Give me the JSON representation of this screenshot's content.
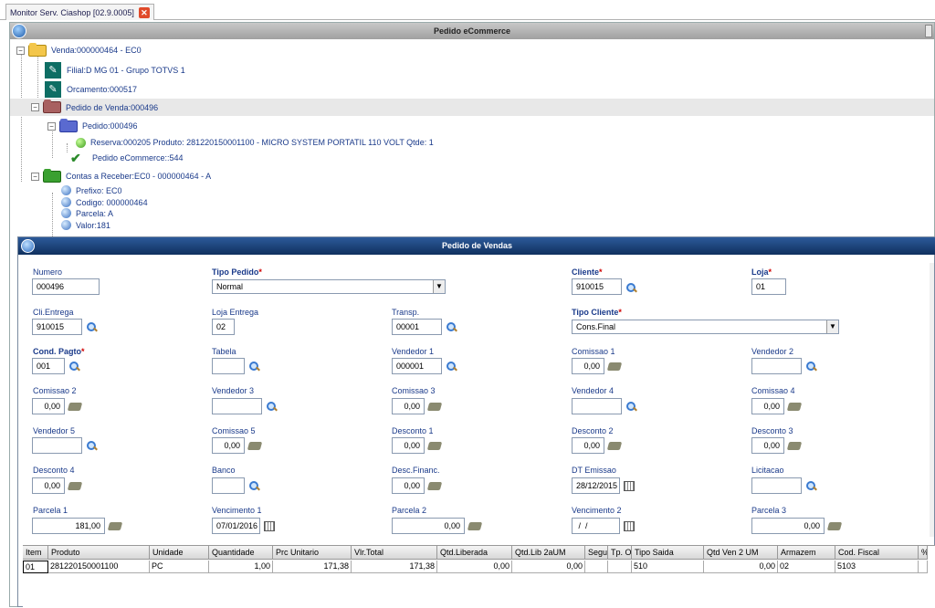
{
  "tab": {
    "title": "Monitor Serv. Ciashop [02.9.0005]"
  },
  "outer_title": "Pedido eCommerce",
  "tree": {
    "venda": "Venda:000000464 - EC0",
    "filial": "Filial:D MG 01  - Grupo TOTVS 1",
    "orcamento": "Orcamento:000517",
    "pedido_venda": "Pedido de Venda:000496",
    "pedido": "Pedido:000496",
    "reserva": "Reserva:000205 Produto: 281220150001100 - MICRO SYSTEM PORTATIL 110 VOLT Qtde: 1",
    "pedido_ecommerce": "Pedido eCommerce::544",
    "contas": "Contas a Receber:EC0 - 000000464 - A",
    "prefixo": "Prefixo: EC0",
    "codigo": "Codigo: 000000464",
    "parcela": "Parcela: A",
    "valor": "Valor:181"
  },
  "panel_title": "Pedido de Vendas",
  "form": {
    "numero": {
      "label": "Numero",
      "value": "000496"
    },
    "tipo_pedido": {
      "label": "Tipo Pedido",
      "value": "Normal"
    },
    "cliente": {
      "label": "Cliente",
      "value": "910015"
    },
    "loja": {
      "label": "Loja",
      "value": "01"
    },
    "cli_entrega": {
      "label": "Cli.Entrega",
      "value": "910015"
    },
    "loja_entrega": {
      "label": "Loja Entrega",
      "value": "02"
    },
    "transp": {
      "label": "Transp.",
      "value": "00001"
    },
    "tipo_cliente": {
      "label": "Tipo Cliente",
      "value": "Cons.Final"
    },
    "cond_pagto": {
      "label": "Cond. Pagto",
      "value": "001"
    },
    "tabela": {
      "label": "Tabela",
      "value": ""
    },
    "vendedor1": {
      "label": "Vendedor 1",
      "value": "000001"
    },
    "comissao1": {
      "label": "Comissao 1",
      "value": "0,00"
    },
    "vendedor2": {
      "label": "Vendedor 2",
      "value": ""
    },
    "comissao2": {
      "label": "Comissao 2",
      "value": "0,00"
    },
    "vendedor3": {
      "label": "Vendedor 3",
      "value": ""
    },
    "comissao3": {
      "label": "Comissao 3",
      "value": "0,00"
    },
    "vendedor4": {
      "label": "Vendedor 4",
      "value": ""
    },
    "comissao4": {
      "label": "Comissao 4",
      "value": "0,00"
    },
    "vendedor5": {
      "label": "Vendedor 5",
      "value": ""
    },
    "comissao5": {
      "label": "Comissao 5",
      "value": "0,00"
    },
    "desconto1": {
      "label": "Desconto 1",
      "value": "0,00"
    },
    "desconto2": {
      "label": "Desconto 2",
      "value": "0,00"
    },
    "desconto3": {
      "label": "Desconto 3",
      "value": "0,00"
    },
    "desconto4": {
      "label": "Desconto 4",
      "value": "0,00"
    },
    "banco": {
      "label": "Banco",
      "value": ""
    },
    "desc_financ": {
      "label": "Desc.Financ.",
      "value": "0,00"
    },
    "dt_emissao": {
      "label": "DT Emissao",
      "value": "28/12/2015"
    },
    "licitacao": {
      "label": "Licitacao",
      "value": ""
    },
    "parcela1": {
      "label": "Parcela 1",
      "value": "181,00"
    },
    "vencimento1": {
      "label": "Vencimento 1",
      "value": "07/01/2016"
    },
    "parcela2": {
      "label": "Parcela 2",
      "value": "0,00"
    },
    "vencimento2": {
      "label": "Vencimento 2",
      "value": " /  / "
    },
    "parcela3": {
      "label": "Parcela 3",
      "value": "0,00"
    }
  },
  "grid": {
    "headers": [
      "Item",
      "Produto",
      "Unidade",
      "Quantidade",
      "Prc Unitario",
      "Vlr.Total",
      "Qtd.Liberada",
      "Qtd.Lib 2aUM",
      "Segu",
      "Tp. O",
      "Tipo Saida",
      "Qtd Ven 2 UM",
      "Armazem",
      "Cod. Fiscal",
      "%"
    ],
    "rows": [
      [
        "01",
        "281220150001100",
        "PC",
        "1,00",
        "171,38",
        "171,38",
        "0,00",
        "0,00",
        "",
        "",
        "510",
        "0,00",
        "02",
        "5103",
        ""
      ]
    ]
  },
  "colors": {
    "panel_title_bg": "#1c447a",
    "required_star": "#d00000",
    "label": "#1a3a8a"
  }
}
